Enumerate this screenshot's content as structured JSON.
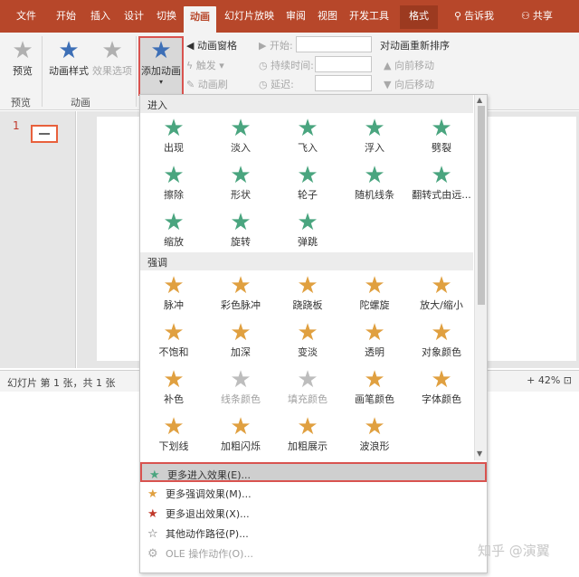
{
  "tabs": [
    "文件",
    "开始",
    "插入",
    "设计",
    "切换",
    "动画",
    "幻灯片放映",
    "审阅",
    "视图",
    "开发工具",
    "格式"
  ],
  "tell_me": "告诉我",
  "share": "共享",
  "ribbon": {
    "preview": "预览",
    "preview_group": "预览",
    "anim_style": "动画样式",
    "effect_options": "效果选项",
    "anim_group": "动画",
    "add_animation": "添加动画",
    "anim_pane": "动画窗格",
    "trigger": "触发",
    "anim_painter": "动画刷",
    "start": "开始:",
    "duration": "持续时间:",
    "delay": "延迟:",
    "reorder": "对动画重新排序",
    "move_earlier": "向前移动",
    "move_later": "向后移动"
  },
  "slide_number": "1",
  "status": {
    "slide_info": "幻灯片 第 1 张，共 1 张",
    "zoom": "42%"
  },
  "gallery": {
    "cat_entrance": "进入",
    "cat_emphasis": "强调",
    "entrance": [
      "出现",
      "淡入",
      "飞入",
      "浮入",
      "劈裂",
      "擦除",
      "形状",
      "轮子",
      "随机线条",
      "翻转式由远...",
      "缩放",
      "旋转",
      "弹跳"
    ],
    "emphasis": [
      "脉冲",
      "彩色脉冲",
      "跷跷板",
      "陀螺旋",
      "放大/缩小",
      "不饱和",
      "加深",
      "变淡",
      "透明",
      "对象颜色",
      "补色",
      "线条颜色",
      "填充颜色",
      "画笔颜色",
      "字体颜色",
      "下划线",
      "加粗闪烁",
      "加粗展示",
      "波浪形"
    ],
    "menu": [
      "更多进入效果(E)...",
      "更多强调效果(M)...",
      "更多退出效果(X)...",
      "其他动作路径(P)...",
      "OLE 操作动作(O)..."
    ]
  },
  "colors": {
    "accent": "#b7472a",
    "entrance_star": "#4aa57f",
    "emphasis_star": "#e0a040",
    "exit_star": "#c0392b",
    "highlight": "#d9534f"
  },
  "watermark": "知乎 @演翼"
}
